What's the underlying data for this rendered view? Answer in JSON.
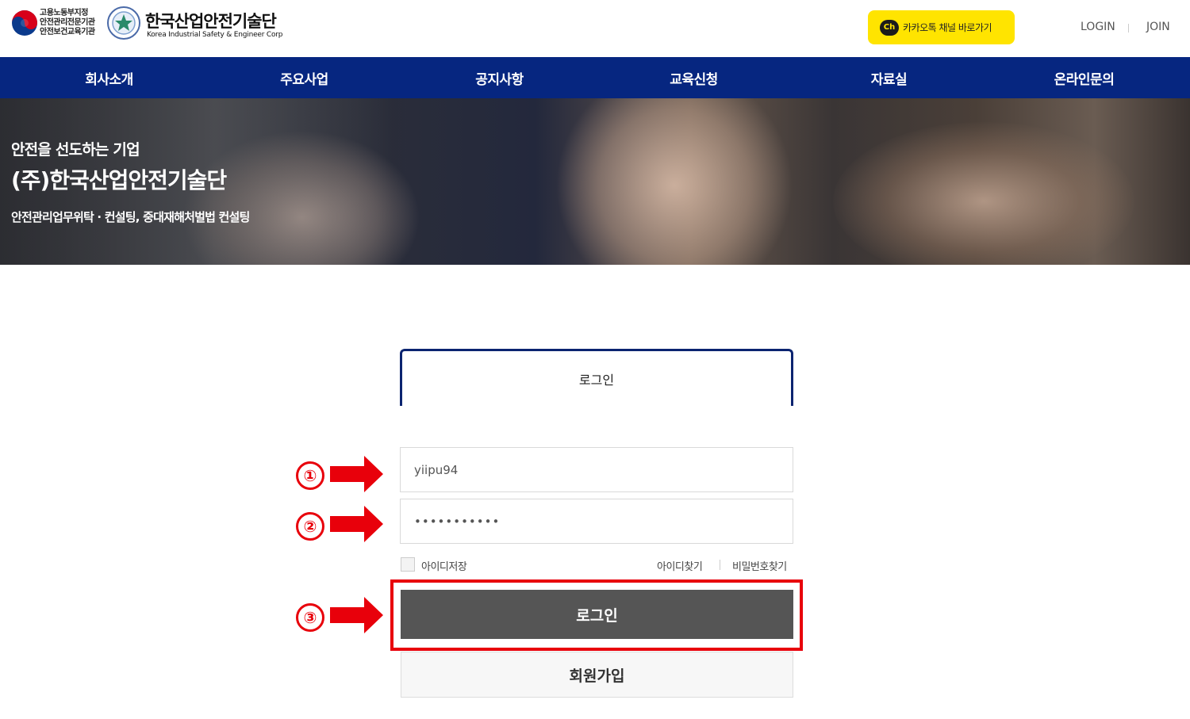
{
  "header": {
    "gov_lines": [
      "고용노동부지정",
      "안전관리전문기관",
      "안전보건교육기관"
    ],
    "corp_name": "한국산업안전기술단",
    "corp_eng": "Korea Industrial Safety & Engineer Corp",
    "kakao_icon_text": "Ch",
    "kakao_label": "카카오톡 채널 바로가기",
    "login_link": "LOGIN",
    "join_link": "JOIN"
  },
  "nav": {
    "items": [
      "회사소개",
      "주요사업",
      "공지사항",
      "교육신청",
      "자료실",
      "온라인문의"
    ],
    "color": "#062680"
  },
  "hero": {
    "subtitle": "안전을 선도하는 기업",
    "title": "(주)한국산업안전기술단",
    "description": "안전관리업무위탁 · 컨설팅, 중대재해처벌법 컨설팅"
  },
  "login": {
    "tab_label": "로그인",
    "id_value": "yiipu94",
    "password_value": "•••••••••••",
    "save_id_label": "아이디저장",
    "find_id_label": "아이디찾기",
    "find_pw_label": "비밀번호찾기",
    "login_button": "로그인",
    "join_button": "회원가입",
    "login_button_color": "#555555"
  },
  "annotations": {
    "steps": [
      "①",
      "②",
      "③"
    ],
    "color": "#e8000b"
  }
}
